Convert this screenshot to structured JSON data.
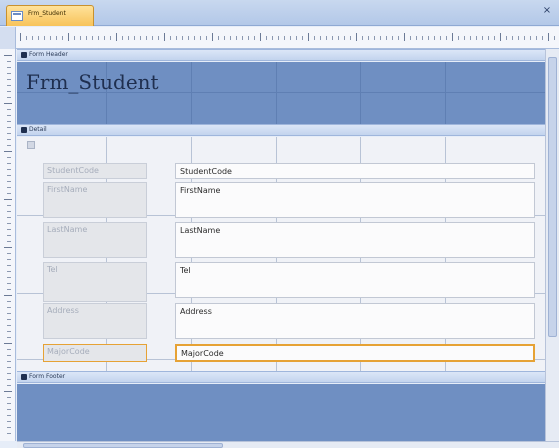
{
  "tab": {
    "label": "Frm_Student",
    "icon": "form-icon"
  },
  "window": {
    "close_glyph": "×"
  },
  "sections": {
    "form_header": "Form Header",
    "detail": "Detail",
    "form_footer": "Form Footer"
  },
  "header": {
    "title": "Frm_Student"
  },
  "fields": [
    {
      "label": "StudentCode",
      "value": "StudentCode"
    },
    {
      "label": "FirstName",
      "value": "FirstName"
    },
    {
      "label": "LastName",
      "value": "LastName"
    },
    {
      "label": "Tel",
      "value": "Tel"
    },
    {
      "label": "Address",
      "value": "Address"
    },
    {
      "label": "MajorCode",
      "value": "MajorCode",
      "selected": true
    }
  ],
  "colors": {
    "header_band": "#6f8fc2",
    "selection": "#e6a235",
    "tab": "#f7c35a"
  }
}
